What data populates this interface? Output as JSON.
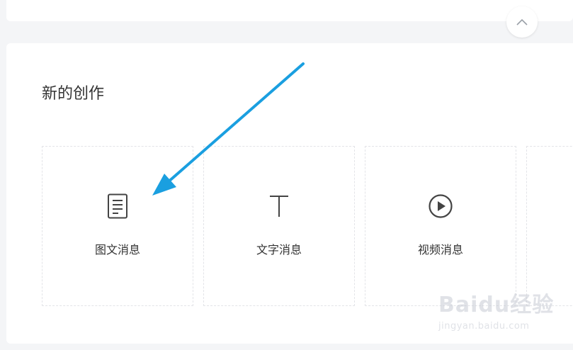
{
  "section": {
    "title": "新的创作"
  },
  "tiles": [
    {
      "label": "图文消息",
      "icon": "article-icon"
    },
    {
      "label": "文字消息",
      "icon": "text-icon"
    },
    {
      "label": "视频消息",
      "icon": "play-circle-icon"
    }
  ],
  "colors": {
    "arrow": "#1a9fe0",
    "icon": "#444444",
    "border": "#e3e4e8"
  },
  "watermark": {
    "logo": "Baidu经验",
    "url": "jingyan.baidu.com"
  }
}
